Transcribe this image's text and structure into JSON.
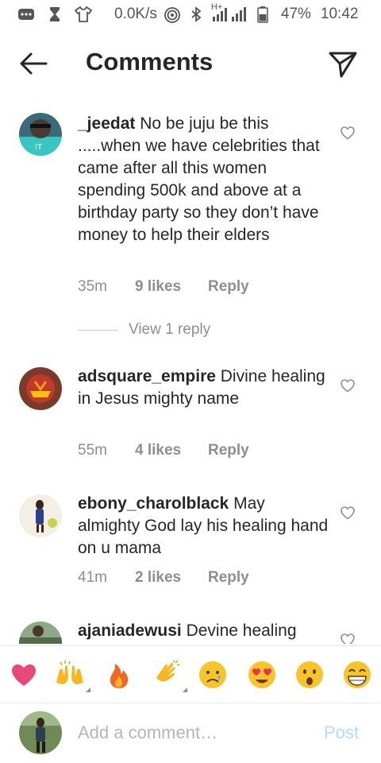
{
  "status_bar": {
    "speed": "0.0K/s",
    "network": "H+",
    "battery": "47%",
    "time": "10:42"
  },
  "header": {
    "title": "Comments",
    "back_icon": "arrow-left-icon",
    "share_icon": "paper-plane-icon"
  },
  "comments": [
    {
      "username": "_jeedat",
      "text": "No be juju be this .....when we have celebrities that came after all this women spending 500k and above at a birthday party so they don’t have money to help their elders",
      "time": "35m",
      "likes": "9 likes",
      "reply": "Reply",
      "view_replies": "View 1 reply"
    },
    {
      "username": "adsquare_empire",
      "text": "Divine healing in Jesus mighty name",
      "time": "55m",
      "likes": "4 likes",
      "reply": "Reply"
    },
    {
      "username": "ebony_charolblack",
      "text": "May almighty God  lay his healing hand on u mama",
      "time": "41m",
      "likes": "2 likes",
      "reply": "Reply"
    },
    {
      "username": "ajaniadewusi",
      "text": "Devine healing"
    }
  ],
  "emoji_bar": [
    "heart",
    "raising-hands",
    "fire",
    "clapping-hands",
    "sad-face",
    "heart-eyes-face",
    "surprised-face",
    "grinning-face"
  ],
  "composer": {
    "placeholder": "Add a comment…",
    "post_label": "Post"
  },
  "colors": {
    "text": "#262626",
    "secondary": "#8e8e8e",
    "post_disabled": "#b3dbff",
    "heart_emoji": "#e8487a"
  }
}
